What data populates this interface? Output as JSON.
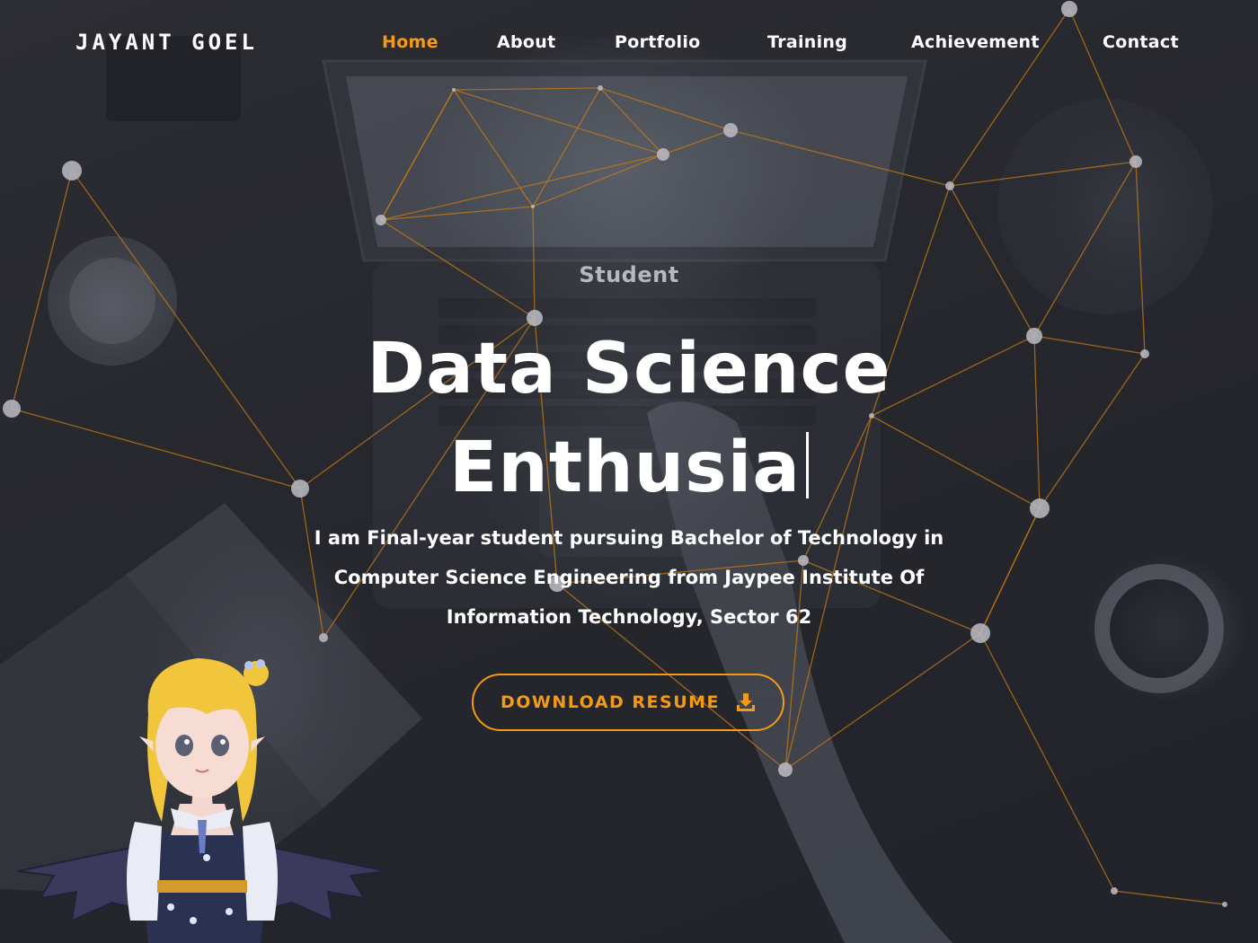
{
  "brand": "JAYANT GOEL",
  "nav": {
    "items": [
      {
        "label": "Home",
        "active": true
      },
      {
        "label": "About",
        "active": false
      },
      {
        "label": "Portfolio",
        "active": false
      },
      {
        "label": "Training",
        "active": false
      },
      {
        "label": "Achievement",
        "active": false
      },
      {
        "label": "Contact",
        "active": false
      }
    ]
  },
  "hero": {
    "subtitle": "Student",
    "title_line1": "Data Science",
    "title_line2": "Enthusia",
    "description_lines": [
      "I am Final-year student pursuing Bachelor of Technology in",
      "Computer Science Engineering from Jaypee Institute Of",
      "Information Technology, Sector 62"
    ],
    "button_label": "DOWNLOAD RESUME",
    "button_icon": "download-icon"
  },
  "colors": {
    "accent": "#f59a13",
    "background": "#24252b",
    "text": "#ffffff",
    "muted": "#b8b8bc"
  }
}
